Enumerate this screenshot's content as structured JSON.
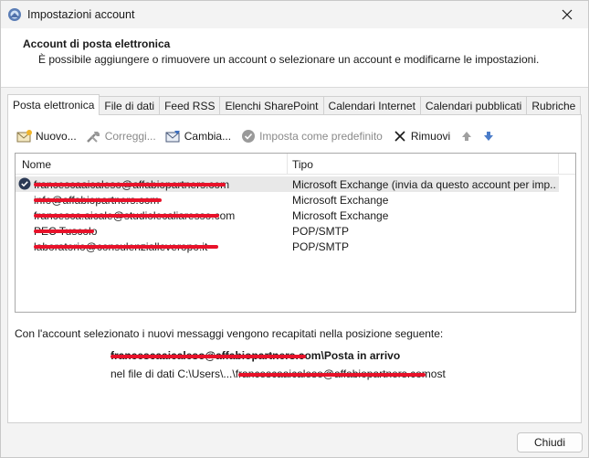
{
  "window": {
    "title": "Impostazioni account"
  },
  "header": {
    "title": "Account di posta elettronica",
    "description": "È possibile aggiungere o rimuovere un account o selezionare un account e modificarne le impostazioni."
  },
  "tabs": [
    {
      "label": "Posta elettronica",
      "active": true
    },
    {
      "label": "File di dati"
    },
    {
      "label": "Feed RSS"
    },
    {
      "label": "Elenchi SharePoint"
    },
    {
      "label": "Calendari Internet"
    },
    {
      "label": "Calendari pubblicati"
    },
    {
      "label": "Rubriche"
    }
  ],
  "toolbar": {
    "new_label": "Nuovo...",
    "repair_label": "Correggi...",
    "change_label": "Cambia...",
    "set_default_label": "Imposta come predefinito",
    "remove_label": "Rimuovi"
  },
  "list": {
    "col_name": "Nome",
    "col_type": "Tipo",
    "rows": [
      {
        "name": "francescaaicaleso@affabiopartners.com",
        "type": "Microsoft Exchange (invia da questo account per imp...",
        "selected": true
      },
      {
        "name": "info@affabiopartners.com",
        "type": "Microsoft Exchange"
      },
      {
        "name": "francesca.aicale@studiolecaliaresso.com",
        "type": "Microsoft Exchange"
      },
      {
        "name": "PEC Tuscolo",
        "type": "POP/SMTP"
      },
      {
        "name": "laboratorio@consulenzialleveropo.it",
        "type": "POP/SMTP"
      }
    ]
  },
  "delivery": {
    "info": "Con l'account selezionato i nuovi messaggi vengono recapitati nella posizione seguente:",
    "account": "francescaaicaleso@affabiopartners.com",
    "folder_label": "Posta in arrivo",
    "file_prefix": "nel file di dati C:\\Users\\...\\",
    "file_name": "francescaaicaleso@affabiopartners.com",
    "file_suffix": "ost"
  },
  "footer": {
    "close_label": "Chiudi"
  },
  "colors": {
    "redaction": "#e8122a",
    "accent": "#4a7cc9"
  }
}
